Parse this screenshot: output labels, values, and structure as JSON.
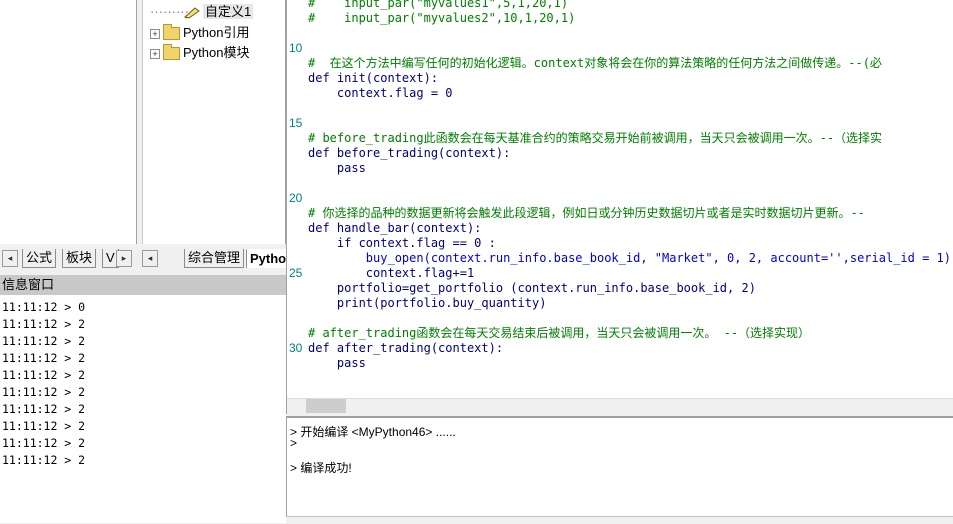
{
  "left_tabs": [
    "公式",
    "板块",
    "V"
  ],
  "tree": {
    "items": [
      {
        "label": "自定义1"
      },
      {
        "label": "Python引用"
      },
      {
        "label": "Python模块"
      }
    ]
  },
  "tree_tabs": [
    "综合管理",
    "Pytho"
  ],
  "info_window": {
    "title": "信息窗口",
    "lines": [
      "11:11:12 > 0",
      "11:11:12 > 2",
      "11:11:12 > 2",
      "11:11:12 > 2",
      "11:11:12 > 2",
      "11:11:12 > 2",
      "11:11:12 > 2",
      "11:11:12 > 2",
      "11:11:12 > 2",
      "11:11:12 > 2"
    ]
  },
  "editor": {
    "line_numbers": [
      "10",
      "15",
      "20",
      "25",
      "30"
    ],
    "lines": [
      "#    input_par(\"myvalues1\",5,1,20,1)",
      "#    input_par(\"myvalues2\",10,1,20,1)",
      "#  在这个方法中编写任何的初始化逻辑。context对象将会在你的算法策略的任何方法之间做传递。--(必",
      "def init(context):",
      "    context.flag = 0",
      "# before_trading此函数会在每天基准合约的策略交易开始前被调用，当天只会被调用一次。--（选择实",
      "def before_trading(context):",
      "    pass",
      "# 你选择的品种的数据更新将会触发此段逻辑，例如日或分钟历史数据切片或者是实时数据切片更新。--",
      "def handle_bar(context):",
      "    if context.flag == 0 :",
      "        buy_open(context.run_info.base_book_id, \"Market\", 0, 2, account='',serial_id = 1)",
      "        context.flag+=1",
      "    portfolio=get_portfolio (context.run_info.base_book_id, 2)",
      "    print(portfolio.buy_quantity)",
      "# after_trading函数会在每天交易结束后被调用，当天只会被调用一次。 --（选择实现）",
      "def after_trading(context):",
      "    pass"
    ]
  },
  "output": {
    "lines": [
      "> 开始编译 <MyPython46> ......",
      ">",
      "> 编译成功!"
    ]
  },
  "colors": {
    "comment": "#008000",
    "keyword": "#00007f",
    "line_number": "#008080",
    "string": "#7f007f",
    "builtin": "#0000d0"
  }
}
